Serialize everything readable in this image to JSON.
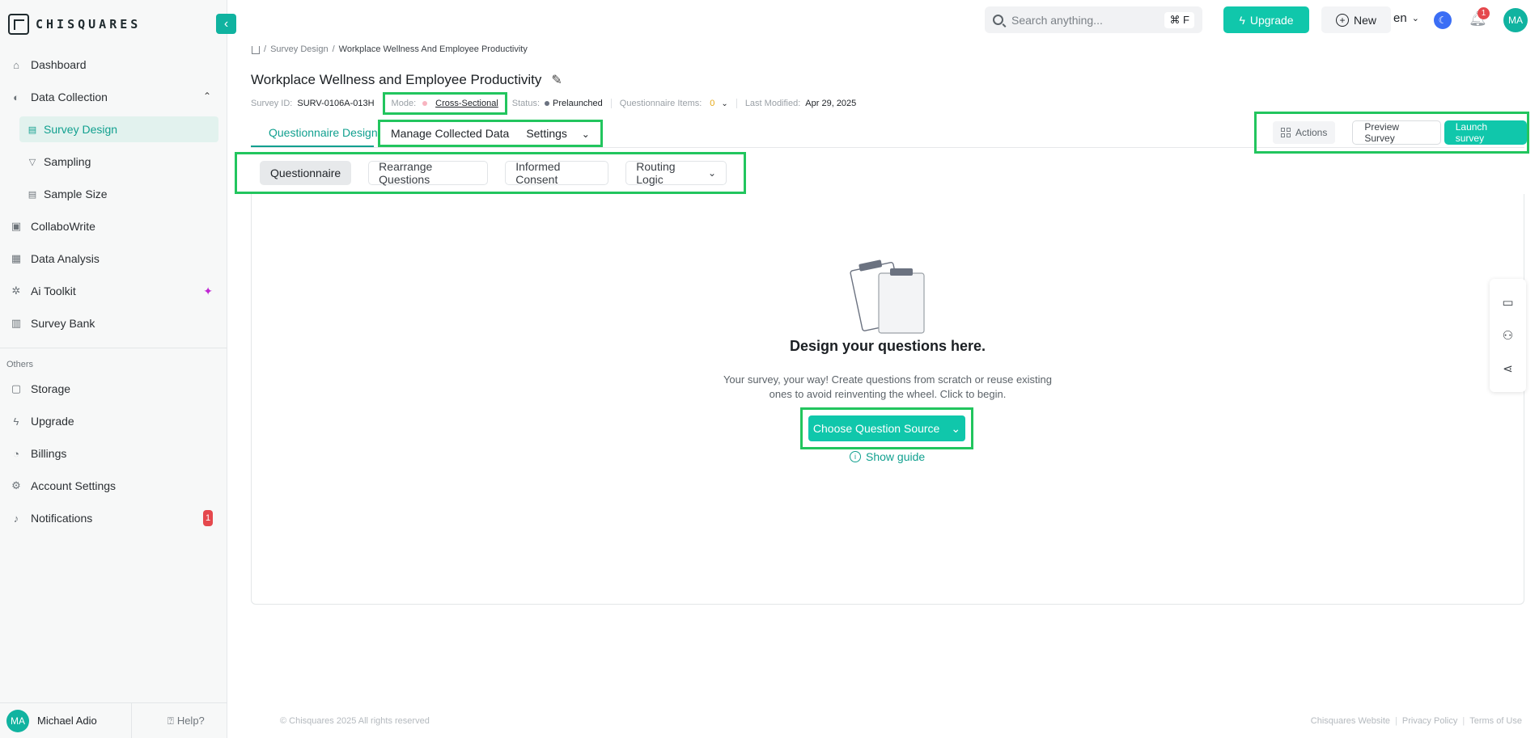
{
  "brand": {
    "name": "CHISQUARES"
  },
  "sidebar": {
    "items": [
      {
        "label": "Dashboard",
        "icon": "home-icon"
      },
      {
        "label": "Data Collection",
        "icon": "data-collection-icon"
      },
      {
        "label": "Survey Design",
        "icon": "file-icon",
        "active": true
      },
      {
        "label": "Sampling",
        "icon": "funnel-icon"
      },
      {
        "label": "Sample Size",
        "icon": "file-icon"
      },
      {
        "label": "CollaboWrite",
        "icon": "collabowrite-icon"
      },
      {
        "label": "Data Analysis",
        "icon": "analysis-icon"
      },
      {
        "label": "Ai Toolkit",
        "icon": "ai-toolkit-icon"
      },
      {
        "label": "Survey Bank",
        "icon": "survey-bank-icon"
      }
    ],
    "others_label": "Others",
    "other_items": [
      {
        "label": "Storage",
        "icon": "folder-icon"
      },
      {
        "label": "Upgrade",
        "icon": "bolt-icon"
      },
      {
        "label": "Billings",
        "icon": "billing-icon"
      },
      {
        "label": "Account Settings",
        "icon": "gear-icon"
      },
      {
        "label": "Notifications",
        "icon": "bell-icon",
        "badge": "1"
      }
    ],
    "user": {
      "initials": "MA",
      "name": "Michael Adio"
    },
    "help_label": "Help?"
  },
  "topbar": {
    "search_placeholder": "Search anything...",
    "search_shortcut": "⌘ F",
    "upgrade_label": "Upgrade",
    "new_label": "New",
    "language": "en",
    "notification_count": "1",
    "avatar_initials": "MA"
  },
  "breadcrumb": {
    "items": [
      "Survey Design"
    ],
    "current": "Workplace Wellness And Employee Productivity"
  },
  "survey": {
    "title": "Workplace Wellness and Employee Productivity",
    "id_label": "Survey ID:",
    "id_value": "SURV-0106A-013H",
    "mode_label": "Mode:",
    "mode_value": "Cross-Sectional",
    "status_label": "Status:",
    "status_value": "Prelaunched",
    "items_label": "Questionnaire Items:",
    "items_value": "0",
    "modified_label": "Last Modified:",
    "modified_value": "Apr 29, 2025"
  },
  "tabs": {
    "active": "Questionnaire Design",
    "others": [
      "Manage Collected Data",
      "Settings"
    ]
  },
  "header_actions": {
    "actions_label": "Actions",
    "preview_label": "Preview Survey",
    "launch_label": "Launch survey"
  },
  "subtabs": [
    "Questionnaire",
    "Rearrange Questions",
    "Informed Consent",
    "Routing Logic"
  ],
  "empty_state": {
    "title": "Design your questions here.",
    "description": "Your survey, your way! Create questions from scratch or reuse existing ones to avoid reinventing the wheel. Click to begin.",
    "button_label": "Choose Question Source",
    "guide_label": "Show guide"
  },
  "footer": {
    "copyright": "© Chisquares 2025 All rights reserved",
    "links": [
      "Chisquares Website",
      "Privacy Policy",
      "Terms of Use"
    ]
  },
  "colors": {
    "accent": "#10c7ab",
    "highlight": "#22c55e",
    "badge": "#e5484d"
  }
}
